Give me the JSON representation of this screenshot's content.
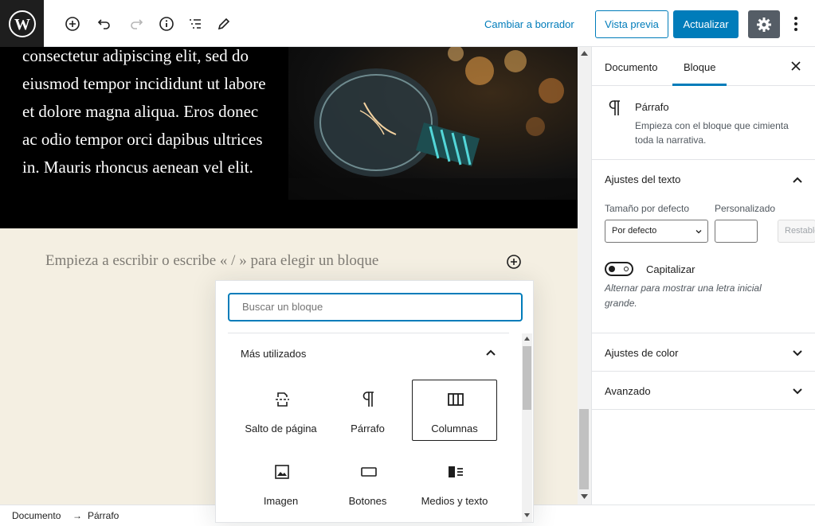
{
  "toolbar": {
    "draft_link": "Cambiar a borrador",
    "preview_label": "Vista previa",
    "update_label": "Actualizar"
  },
  "editor": {
    "media_text_body": "consectetur adipiscing elit, sed do eiusmod tempor incididunt ut labore et dolore magna aliqua. Eros donec ac odio tempor orci dapibus ultrices in. Mauris rhoncus aenean vel elit.",
    "placeholder": "Empieza a escribir o escribe « / » para elegir un bloque"
  },
  "sidebar": {
    "tabs": [
      {
        "label": "Documento"
      },
      {
        "label": "Bloque"
      }
    ],
    "active_tab": "Bloque",
    "block": {
      "name": "Párrafo",
      "description": "Empieza con el bloque que cimienta toda la narrativa."
    },
    "text_settings": {
      "title": "Ajustes del texto",
      "size_label": "Tamaño por defecto",
      "custom_label": "Personalizado",
      "size_select_value": "Por defecto",
      "reset_label": "Restablecer",
      "dropcap_label": "Capitalizar",
      "dropcap_help": "Alternar para mostrar una letra inicial grande."
    },
    "color_settings": {
      "title": "Ajustes de color"
    },
    "advanced": {
      "title": "Avanzado"
    }
  },
  "inserter": {
    "search_placeholder": "Buscar un bloque",
    "section_title": "Más utilizados",
    "blocks": [
      {
        "label": "Salto de página",
        "icon": "page-break-icon"
      },
      {
        "label": "Párrafo",
        "icon": "paragraph-icon"
      },
      {
        "label": "Columnas",
        "icon": "columns-icon",
        "selected": true
      },
      {
        "label": "Imagen",
        "icon": "image-icon"
      },
      {
        "label": "Botones",
        "icon": "buttons-icon"
      },
      {
        "label": "Medios y texto",
        "icon": "media-text-icon"
      }
    ]
  },
  "footer": {
    "breadcrumb_root": "Documento",
    "breadcrumb_sep": "→",
    "breadcrumb_current": "Párrafo"
  },
  "colors": {
    "accent": "#007cba",
    "dark": "#1e1e1e",
    "editor_bg": "#f4efe2"
  }
}
